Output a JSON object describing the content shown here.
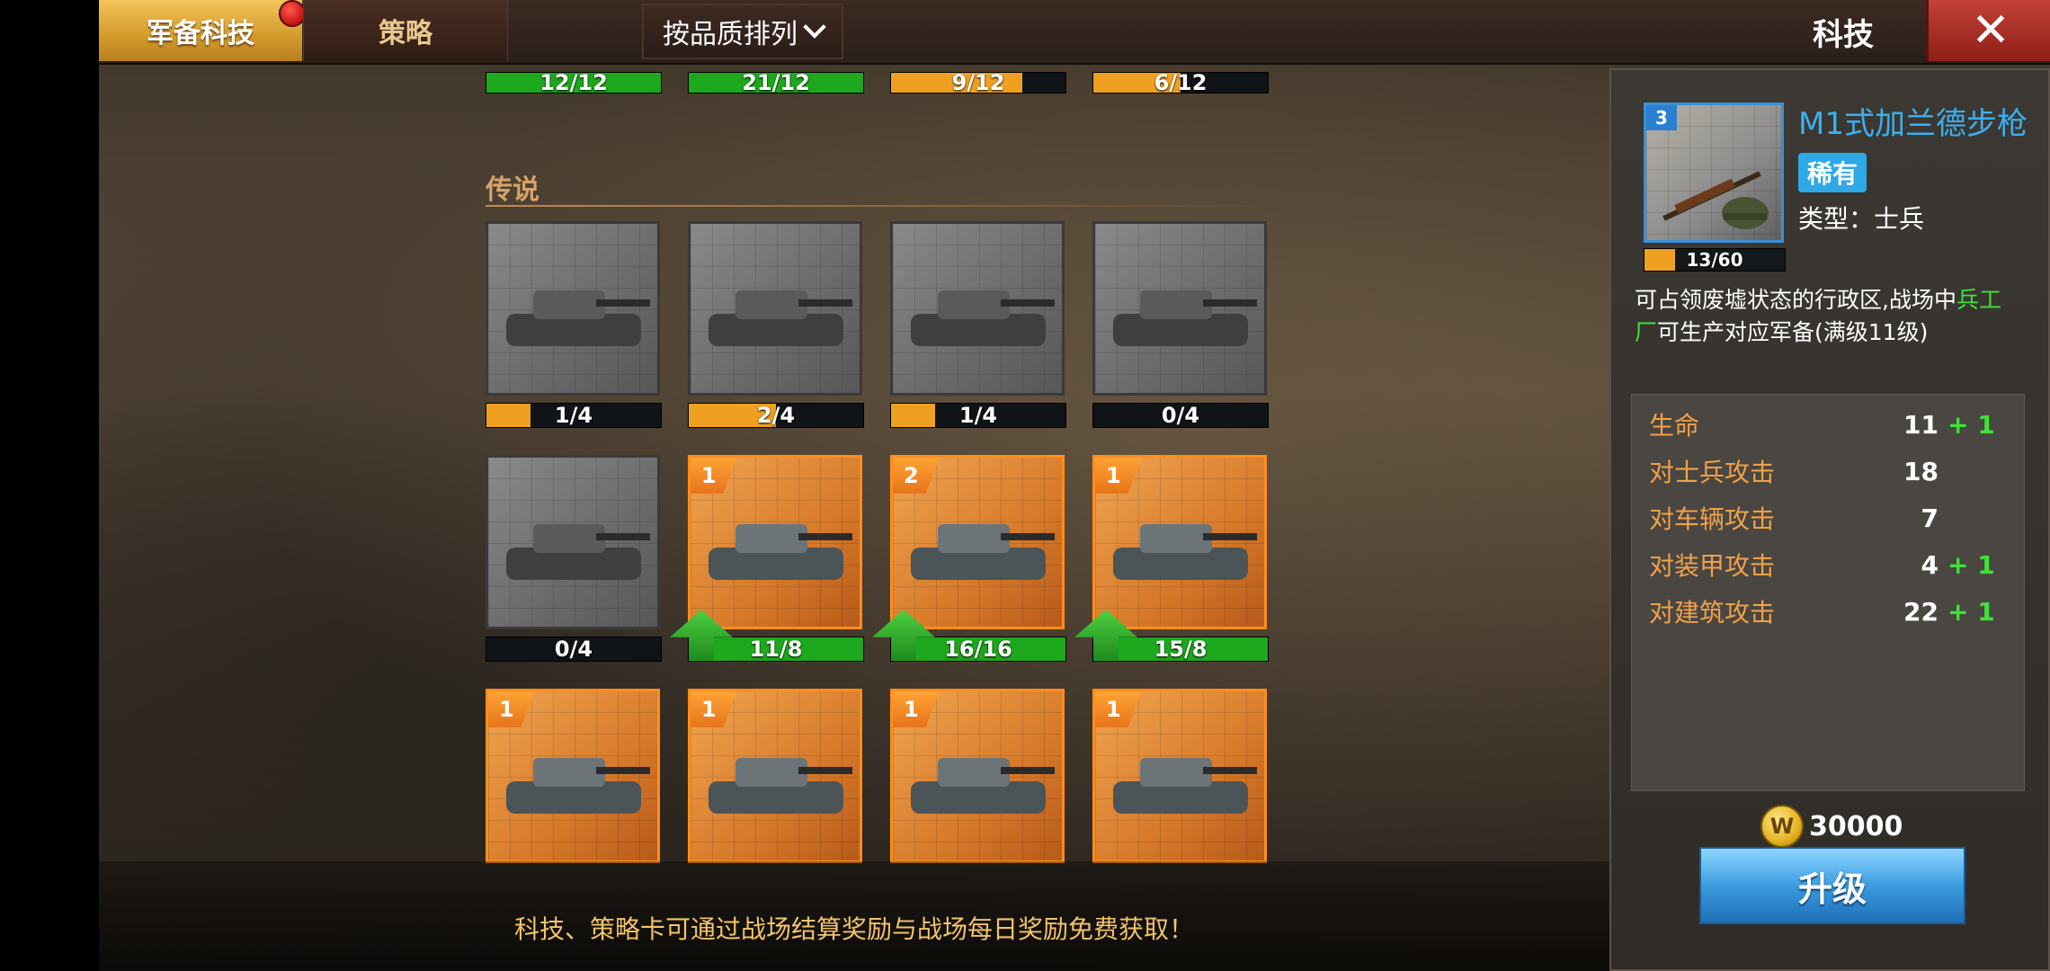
{
  "tabs": {
    "active": "军备科技",
    "second": "策略"
  },
  "sort_button": {
    "label": "按品质排列"
  },
  "header": {
    "title": "科技"
  },
  "top_row_bars": [
    {
      "text": "12/12",
      "progress": 1.0,
      "color": "#1ea81e"
    },
    {
      "text": "21/12",
      "progress": 1.0,
      "color": "#1ea81e"
    },
    {
      "text": "9/12",
      "progress": 0.75,
      "color": "#f0a020"
    },
    {
      "text": "6/12",
      "progress": 0.5,
      "color": "#f0a020"
    }
  ],
  "section": {
    "label": "传说"
  },
  "row1": [
    {
      "kind": "gray",
      "icon": "tank-icon",
      "text": "1/4",
      "progress": 0.25,
      "color": "#f0a020"
    },
    {
      "kind": "gray",
      "icon": "self-propelled-gun-icon",
      "text": "2/4",
      "progress": 0.5,
      "color": "#f0a020"
    },
    {
      "kind": "gray",
      "icon": "tiger-tank-icon",
      "text": "1/4",
      "progress": 0.25,
      "color": "#f0a020"
    },
    {
      "kind": "gray",
      "icon": "tank-destroyer-icon",
      "text": "0/4",
      "progress": 0.0,
      "color": "#f0a020"
    }
  ],
  "row2": [
    {
      "kind": "gray",
      "icon": "king-tiger-tank-icon",
      "text": "0/4",
      "progress": 0.0,
      "color": "#f0a020",
      "level": ""
    },
    {
      "kind": "orange",
      "icon": "maus-tank-icon",
      "text": "11/8",
      "progress": 1.0,
      "color": "#1ea81e",
      "level": "1"
    },
    {
      "kind": "orange",
      "icon": "artillery-tank-icon",
      "text": "16/16",
      "progress": 1.0,
      "color": "#1ea81e",
      "level": "2"
    },
    {
      "kind": "orange",
      "icon": "rocket-truck-icon",
      "text": "15/8",
      "progress": 1.0,
      "color": "#1ea81e",
      "level": "1"
    }
  ],
  "row3": [
    {
      "icon": "bomber-plane-icon",
      "level": "1"
    },
    {
      "icon": "green-bomber-icon",
      "level": "1"
    },
    {
      "icon": "jet-fighter-icon",
      "level": "1"
    },
    {
      "icon": "battleship-icon",
      "level": "1"
    }
  ],
  "detail": {
    "level": "3",
    "name": "M1式加兰德步枪",
    "rarity": "稀有",
    "type": "类型：士兵",
    "portrait_icon": "rifle-helmet-icon",
    "progress_text": "13/60",
    "progress": 0.2166,
    "desc_a": "可占领废墟状态的行政区,战场中",
    "desc_hl": "兵工厂",
    "desc_b": "可生产对应军备(满级11级)",
    "stats": [
      {
        "label": "生命",
        "value": "11",
        "bonus": "+ 1"
      },
      {
        "label": "对士兵攻击",
        "value": "18",
        "bonus": ""
      },
      {
        "label": "对车辆攻击",
        "value": "7",
        "bonus": ""
      },
      {
        "label": "对装甲攻击",
        "value": "4",
        "bonus": "+ 1"
      },
      {
        "label": "对建筑攻击",
        "value": "22",
        "bonus": "+ 1"
      }
    ],
    "cost": "30000",
    "coin_symbol": "W",
    "upgrade_label": "升级"
  },
  "bottom_tip": "科技、策略卡可通过战场结算奖励与战场每日奖励免费获取！",
  "colors": {
    "accent_gold": "#e0a83a",
    "rarity_blue": "#2ea8e6",
    "bonus_green": "#3fe23a",
    "stat_orange": "#f0a24a"
  }
}
